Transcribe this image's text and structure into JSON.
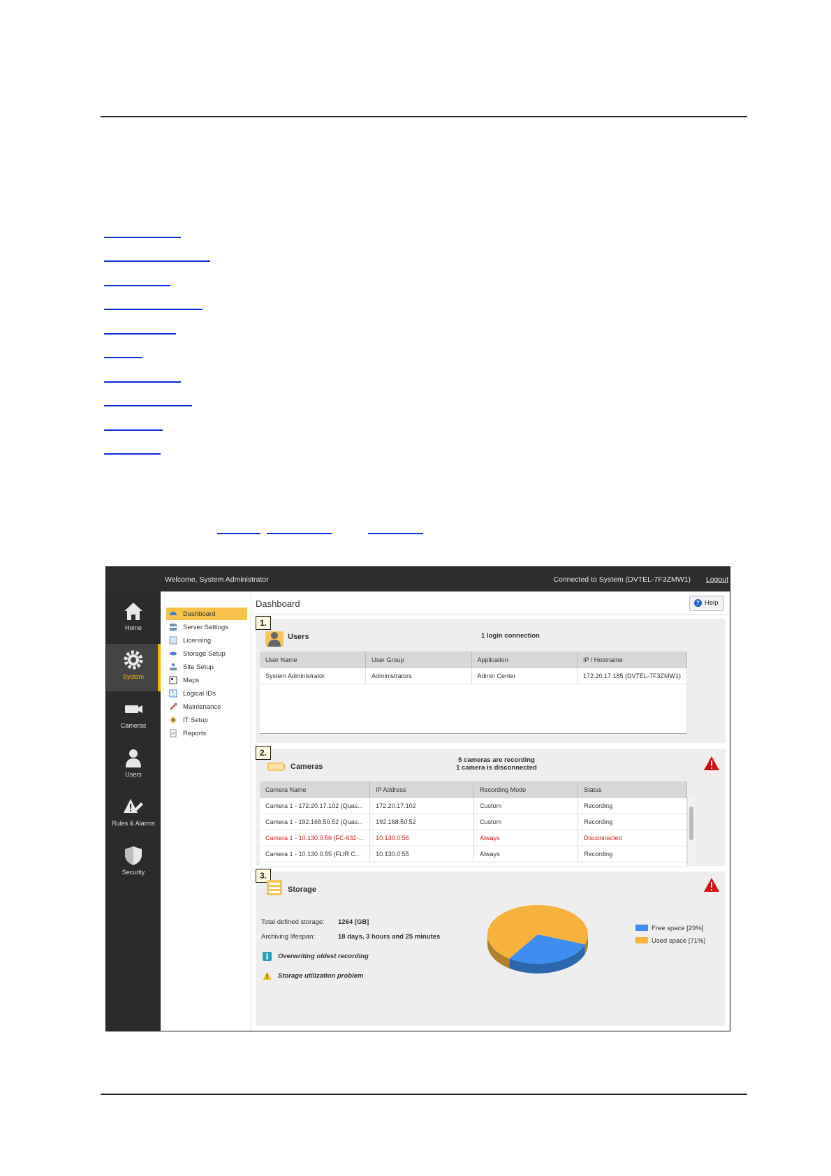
{
  "app": {
    "welcome": "Welcome, System Administrator",
    "connected": "Connected to System (DVTEL-7F3ZMW1)",
    "logout": "Logout"
  },
  "nav": [
    {
      "label": "Home",
      "icon": "home-icon"
    },
    {
      "label": "System",
      "icon": "gear-icon",
      "active": true
    },
    {
      "label": "Cameras",
      "icon": "camera-icon"
    },
    {
      "label": "Users",
      "icon": "user-icon"
    },
    {
      "label": "Rules & Alarms",
      "icon": "rules-alarms-icon"
    },
    {
      "label": "Security",
      "icon": "shield-icon"
    }
  ],
  "submenu": [
    {
      "label": "Dashboard",
      "icon": "dashboard-icon"
    },
    {
      "label": "Server Settings",
      "icon": "server-icon"
    },
    {
      "label": "Licensing",
      "icon": "licensing-icon"
    },
    {
      "label": "Storage Setup",
      "icon": "storage-icon"
    },
    {
      "label": "Site Setup",
      "icon": "site-icon"
    },
    {
      "label": "Maps",
      "icon": "map-icon"
    },
    {
      "label": "Logical IDs",
      "icon": "logical-id-icon"
    },
    {
      "label": "Maintenance",
      "icon": "maintenance-icon"
    },
    {
      "label": "IT Setup",
      "icon": "it-setup-icon"
    },
    {
      "label": "Reports",
      "icon": "reports-icon"
    }
  ],
  "main": {
    "title": "Dashboard",
    "help": "Help"
  },
  "users": {
    "badge": "1.",
    "title": "Users",
    "status": "1 login connection",
    "columns": [
      "User Name",
      "User Group",
      "Application",
      "IP / Hostname"
    ],
    "rows": [
      [
        "System Administrator",
        "Administrators",
        "Admin Center",
        "172.20.17.185 (DVTEL-7F3ZMW1)"
      ]
    ]
  },
  "cameras": {
    "badge": "2.",
    "title": "Cameras",
    "status_line1": "5 cameras are recording",
    "status_line2": "1 camera is disconnected",
    "columns": [
      "Camera Name",
      "IP Address",
      "Recording Mode",
      "Status"
    ],
    "rows": [
      [
        "Camera 1 - 172.20.17.102 (Quas...",
        "172.20.17.102",
        "Custom",
        "Recording"
      ],
      [
        "Camera 1 - 192.168.50.52 (Quas...",
        "192.168.50.52",
        "Custom",
        "Recording"
      ],
      [
        "Camera 1 - 10.130.0.56 (FC-632-...",
        "10.130.0.56",
        "Always",
        "Disconnected"
      ],
      [
        "Camera 1 - 10.130.0.55 (FLIR C...",
        "10.130.0.55",
        "Always",
        "Recording"
      ]
    ],
    "disconnected_row": 2
  },
  "storage": {
    "badge": "3.",
    "title": "Storage",
    "total_label": "Total defined storage:",
    "total_value": "1264 [GB]",
    "lifespan_label": "Archiving lifespan:",
    "lifespan_value": "18 days, 3 hours and 25 minutes",
    "note1": "Overwriting oldest recording",
    "note2": "Storage utilization problem"
  },
  "chart_data": {
    "type": "pie",
    "categories": [
      "Free space [29%]",
      "Used space [71%]"
    ],
    "values": [
      29,
      71
    ],
    "colors": [
      "#3d8ef0",
      "#f7b23b"
    ],
    "legend": "right"
  },
  "colors": {
    "accent": "#f5b400",
    "link": "#0b2bd8",
    "disconnected": "#d31b1b",
    "warning": "#d01010"
  }
}
